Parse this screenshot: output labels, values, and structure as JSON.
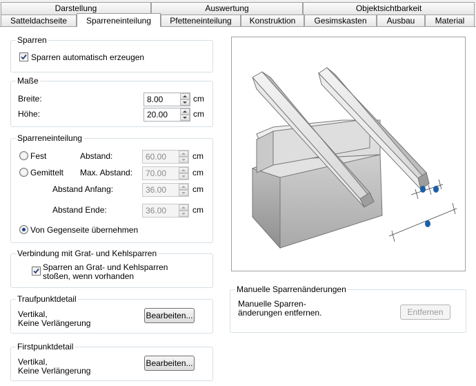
{
  "tabs_top": [
    {
      "label": "Darstellung"
    },
    {
      "label": "Auswertung"
    },
    {
      "label": "Objektsichtbarkeit"
    }
  ],
  "tabs_bottom": [
    {
      "label": "Satteldachseite"
    },
    {
      "label": "Sparreneinteilung"
    },
    {
      "label": "Pfetteneinteilung"
    },
    {
      "label": "Konstruktion"
    },
    {
      "label": "Gesimskasten"
    },
    {
      "label": "Ausbau"
    },
    {
      "label": "Material"
    }
  ],
  "sparren": {
    "title": "Sparren",
    "auto_label": "Sparren automatisch erzeugen",
    "auto_checked": true
  },
  "masse": {
    "title": "Maße",
    "breite_label": "Breite:",
    "breite_value": "8.00",
    "hoehe_label": "Höhe:",
    "hoehe_value": "20.00",
    "unit": "cm"
  },
  "einteilung": {
    "title": "Sparreneinteilung",
    "fest_label": "Fest",
    "gemittelt_label": "Gemittelt",
    "abstand_label": "Abstand:",
    "abstand_value": "60.00",
    "max_abstand_label": "Max. Abstand:",
    "max_abstand_value": "70.00",
    "abstand_anfang_label": "Abstand Anfang:",
    "abstand_anfang_value": "36.00",
    "abstand_ende_label": "Abstand Ende:",
    "abstand_ende_value": "36.00",
    "gegenseite_label": "Von Gegenseite übernehmen",
    "selected": "gegenseite",
    "unit": "cm"
  },
  "verbindung": {
    "title": "Verbindung mit Grat- und Kehlsparren",
    "line1": "Sparren an Grat- und Kehlsparren",
    "line2": "stoßen, wenn vorhanden",
    "checked": true
  },
  "traufpunkt": {
    "title": "Traufpunktdetail",
    "line1": "Vertikal,",
    "line2": "Keine Verlängerung",
    "button": "Bearbeiten..."
  },
  "firstpunkt": {
    "title": "Firstpunktdetail",
    "line1": "Vertikal,",
    "line2": "Keine Verlängerung",
    "button": "Bearbeiten..."
  },
  "manuelle": {
    "title": "Manuelle Sparrenänderungen",
    "line1": "Manuelle Sparren-",
    "line2": "änderungen entfernen.",
    "button": "Entfernen"
  },
  "colors": {
    "accent_dot": "#1b5fa8",
    "group_border": "#d5dfe5"
  }
}
